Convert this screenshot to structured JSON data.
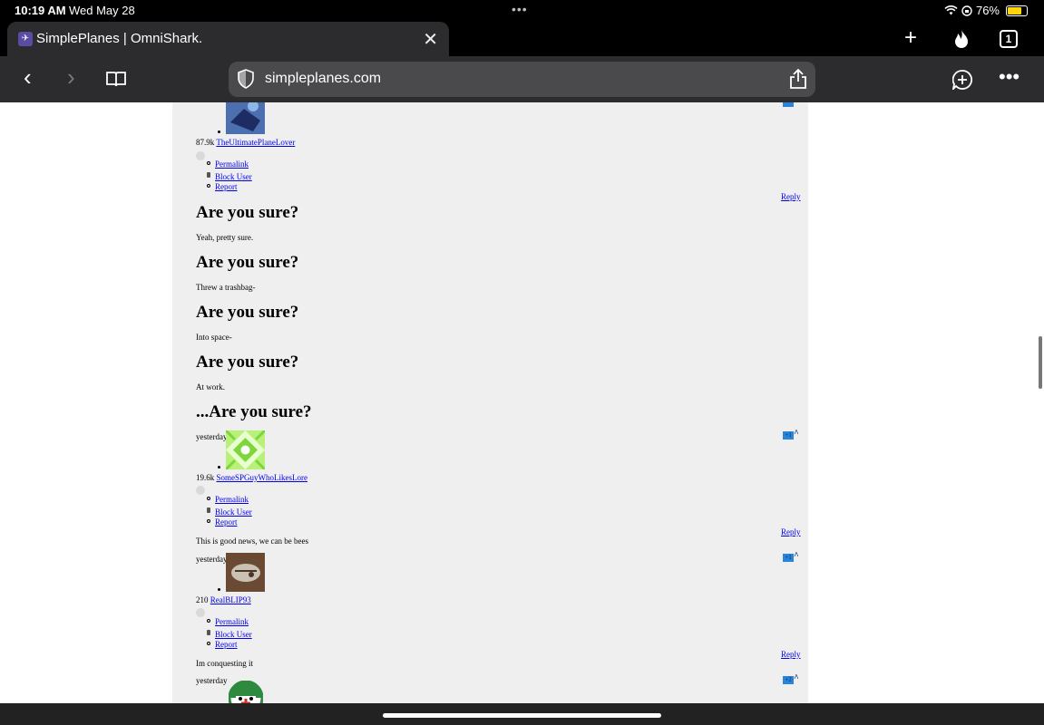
{
  "status": {
    "time": "10:19 AM",
    "date": "Wed May 28",
    "battery": "76%",
    "battery_level": 0.76
  },
  "tab": {
    "title": "SimplePlanes | OmniShark.",
    "count": "1"
  },
  "address": {
    "url": "simpleplanes.com"
  },
  "colors": {
    "link": "#0000ee",
    "vote": "#2a84d9",
    "panel": "#efefef",
    "battery": "#ffd60a"
  },
  "comment_top": {
    "score": "87.9k",
    "user": "TheUltimatePlaneLover",
    "links": [
      "Permalink",
      "Block User",
      "Report"
    ],
    "reply": "Reply"
  },
  "poem": [
    {
      "heading": "Are you sure?",
      "line": "Yeah, pretty sure."
    },
    {
      "heading": "Are you sure?",
      "line": "Threw a trashbag-"
    },
    {
      "heading": "Are you sure?",
      "line": "Into space-"
    },
    {
      "heading": "Are you sure?",
      "line": "At work."
    },
    {
      "heading": "...Are you sure?",
      "line": ""
    }
  ],
  "comments": [
    {
      "when": "yesterday",
      "votes": "+1",
      "score": "19.6k",
      "user": "SomeSPGuyWhoLikesLore",
      "links": [
        "Permalink",
        "Block User",
        "Report"
      ],
      "reply": "Reply",
      "text": "This is good news, we can be bees"
    },
    {
      "when": "yesterday",
      "votes": "+1",
      "score": "210",
      "user": "RealBLIP93",
      "links": [
        "Permalink",
        "Block User",
        "Report"
      ],
      "reply": "Reply",
      "text": "Im conquesting it"
    },
    {
      "when": "yesterday",
      "votes": "+2"
    }
  ]
}
